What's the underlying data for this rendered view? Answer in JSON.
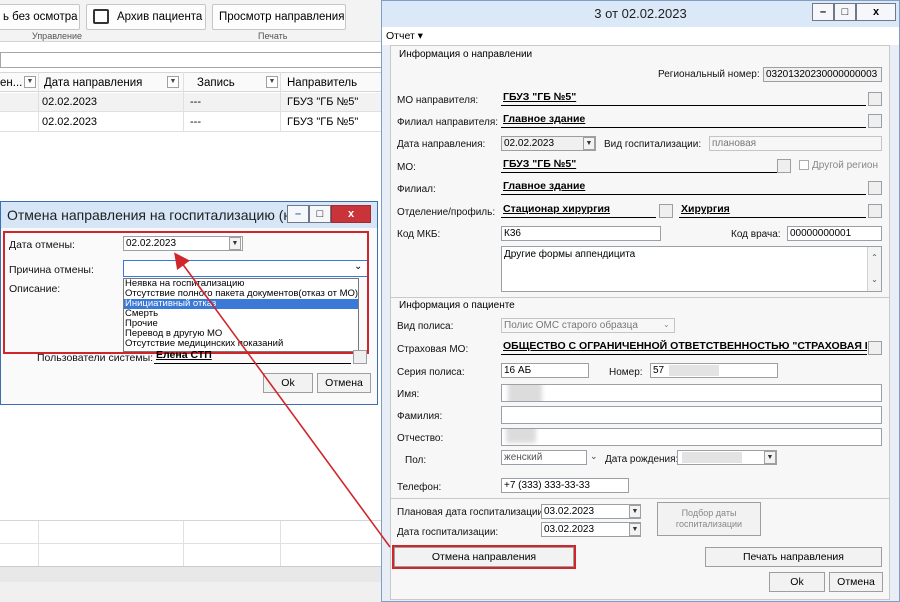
{
  "background_app": {
    "ribbon": {
      "btn_no_exam": "ь без осмотра",
      "btn_archive": "Архив пациента",
      "btn_view": "Просмотр направления",
      "group_manage": "Управление",
      "group_print": "Печать"
    },
    "grid": {
      "columns": [
        "ен...",
        "Дата направления",
        "Запись",
        "Направитель"
      ],
      "rows": [
        {
          "date": "02.02.2023",
          "record": "---",
          "sender": "ГБУЗ \"ГБ №5\""
        },
        {
          "date": "02.02.2023",
          "record": "---",
          "sender": "ГБУЗ \"ГБ №5\""
        }
      ]
    }
  },
  "main_window": {
    "title": "3 от 02.02.2023",
    "controls": {
      "minimize": "–",
      "maximize": "□",
      "close": "x"
    },
    "menu": {
      "report": "Отчет ▾"
    },
    "referral_section": {
      "header": "Информация о направлении",
      "regional_number_label": "Региональный номер:",
      "regional_number": "03201320230000000003",
      "mo_sender_label": "МО направителя:",
      "mo_sender": "ГБУЗ \"ГБ №5\"",
      "branch_sender_label": "Филиал направителя:",
      "branch_sender": "Главное здание",
      "referral_date_label": "Дата направления:",
      "referral_date": "02.02.2023",
      "hosp_type_label": "Вид госпитализации:",
      "hosp_type": "плановая",
      "mo_label": "МО:",
      "mo": "ГБУЗ \"ГБ №5\"",
      "other_region": "Другой регион",
      "branch_label": "Филиал:",
      "branch": "Главное здание",
      "dept_label": "Отделение/профиль:",
      "dept": "Стационар хирургия",
      "profile": "Хирургия",
      "mkb_label": "Код МКБ:",
      "mkb": "К36",
      "doctor_code_label": "Код врача:",
      "doctor_code": "00000000001",
      "diagnosis": "Другие формы аппендицита"
    },
    "patient_section": {
      "header": "Информация о пациенте",
      "policy_type_label": "Вид полиса:",
      "policy_type": "Полис ОМС старого образца",
      "insurer_label": "Страховая МО:",
      "insurer": "ОБЩЕСТВО С ОГРАНИЧЕННОЙ ОТВЕТСТВЕННОСТЬЮ \"СТРАХОВАЯ КО",
      "policy_series_label": "Серия полиса:",
      "policy_series": "16 АБ",
      "number_label": "Номер:",
      "number": "57",
      "first_name_label": "Имя:",
      "last_name_label": "Фамилия:",
      "patronymic_label": "Отчество:",
      "sex_label": "Пол:",
      "sex": "женский",
      "birth_date_label": "Дата рождения:",
      "phone_label": "Телефон:",
      "phone": "+7 (333) 333-33-33"
    },
    "hospitalization": {
      "planned_date_label": "Плановая дата госпитализации:",
      "planned_date": "03.02.2023",
      "hosp_date_label": "Дата госпитализации:",
      "hosp_date": "03.02.2023",
      "pick_date_button": "Подбор даты госпитализации"
    },
    "buttons": {
      "cancel_referral": "Отмена направления",
      "print_referral": "Печать направления",
      "ok": "Ok",
      "cancel": "Отмена"
    }
  },
  "cancel_dialog": {
    "title": "Отмена направления на госпитализацию (но...",
    "cancel_date_label": "Дата отмены:",
    "cancel_date": "02.02.2023",
    "reason_label": "Причина отмены:",
    "reason_value": "",
    "reasons": [
      "Неявка на госпитализацию",
      "Отсутствие полного пакета документов(отказ от МО)",
      "Инициативный отказ",
      "Смерть",
      "Прочие",
      "Перевод в другую МО",
      "Отсутствие медицинских показаний"
    ],
    "selected_reason_index": 2,
    "description_label": "Описание:",
    "system_users_label": "Пользователи системы:",
    "system_user": "Елена СТП",
    "ok": "Ok",
    "cancel": "Отмена"
  },
  "colors": {
    "highlight": "#d0262b",
    "selection": "#3b79d6",
    "title_bar": "#dbe8f7"
  }
}
